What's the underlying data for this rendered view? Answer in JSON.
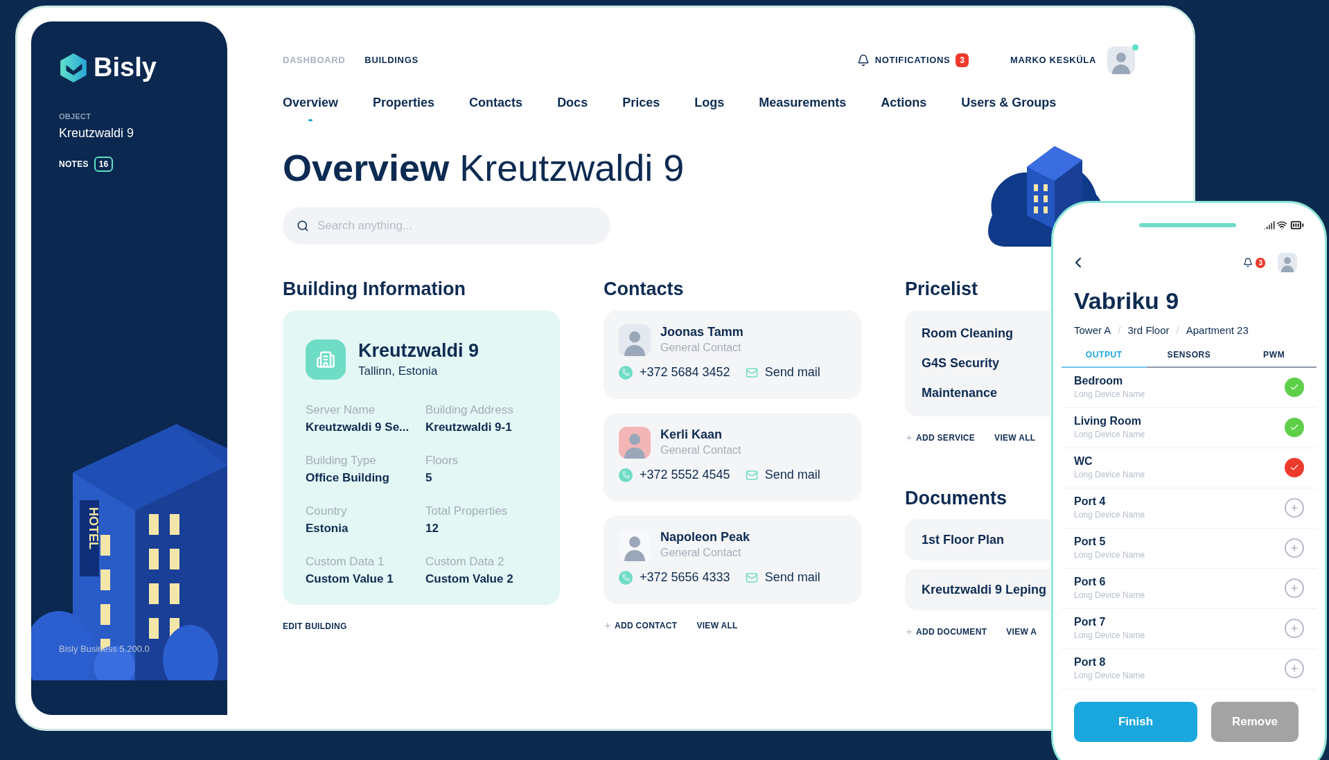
{
  "sidebar": {
    "logo": "Bisly",
    "object_label": "OBJECT",
    "object_name": "Kreutzwaldi 9",
    "notes_label": "NOTES",
    "notes_count": "16",
    "sign": "HOTEL",
    "version": "Bisly Business 5.200.0"
  },
  "topbar": {
    "crumbs": [
      {
        "label": "DASHBOARD",
        "selected": false
      },
      {
        "label": "BUILDINGS",
        "selected": true
      }
    ],
    "notifications_label": "NOTIFICATIONS",
    "notifications_count": "3",
    "user_name": "MARKO KESKÜLA",
    "user_online": true
  },
  "nav": [
    {
      "label": "Overview",
      "selected": true
    },
    {
      "label": "Properties",
      "selected": false
    },
    {
      "label": "Contacts",
      "selected": false
    },
    {
      "label": "Docs",
      "selected": false
    },
    {
      "label": "Prices",
      "selected": false
    },
    {
      "label": "Logs",
      "selected": false
    },
    {
      "label": "Measurements",
      "selected": false
    },
    {
      "label": "Actions",
      "selected": false
    },
    {
      "label": "Users & Groups",
      "selected": false
    }
  ],
  "title": {
    "main": "Overview",
    "sub": "Kreutzwaldi 9"
  },
  "search": {
    "placeholder": "Search anything..."
  },
  "building": {
    "heading": "Building Information",
    "name": "Kreutzwaldi 9",
    "location": "Tallinn, Estonia",
    "fields": [
      {
        "label": "Server Name",
        "value": "Kreutzwaldi 9 Se..."
      },
      {
        "label": "Building Address",
        "value": "Kreutzwaldi 9-1"
      },
      {
        "label": "Building Type",
        "value": "Office Building"
      },
      {
        "label": "Floors",
        "value": "5"
      },
      {
        "label": "Country",
        "value": "Estonia"
      },
      {
        "label": "Total Properties",
        "value": "12"
      },
      {
        "label": "Custom Data 1",
        "value": "Custom Value 1"
      },
      {
        "label": "Custom Data 2",
        "value": "Custom Value 2"
      }
    ],
    "edit_link": "EDIT BUILDING"
  },
  "contacts": {
    "heading": "Contacts",
    "items": [
      {
        "name": "Joonas Tamm",
        "role": "General Contact",
        "phone": "+372 5684 3452",
        "mail": "Send mail"
      },
      {
        "name": "Kerli Kaan",
        "role": "General Contact",
        "phone": "+372 5552 4545",
        "mail": "Send mail"
      },
      {
        "name": "Napoleon Peak",
        "role": "General Contact",
        "phone": "+372 5656 4333",
        "mail": "Send mail"
      }
    ],
    "add_link": "ADD CONTACT",
    "view_link": "VIEW ALL"
  },
  "pricelist": {
    "heading": "Pricelist",
    "items": [
      "Room Cleaning",
      "G4S Security",
      "Maintenance"
    ],
    "add_link": "ADD SERVICE",
    "view_link": "VIEW ALL"
  },
  "documents": {
    "heading": "Documents",
    "items": [
      "1st Floor Plan",
      "Kreutzwaldi 9 Leping"
    ],
    "add_link": "ADD DOCUMENT",
    "view_link": "VIEW A"
  },
  "phone": {
    "notifications_count": "3",
    "title": "Vabriku 9",
    "breadcrumb": [
      "Tower A",
      "3rd Floor",
      "Apartment 23"
    ],
    "separator": "/",
    "tabs": [
      {
        "label": "OUTPUT",
        "selected": true
      },
      {
        "label": "SENSORS",
        "selected": false
      },
      {
        "label": "PWM",
        "selected": false
      }
    ],
    "rows": [
      {
        "name": "Bedroom",
        "device": "Long Device Name",
        "kind": "ok"
      },
      {
        "name": "Living Room",
        "device": "Long Device Name",
        "kind": "ok"
      },
      {
        "name": "WC",
        "device": "Long Device Name",
        "kind": "error"
      },
      {
        "name": "Port 4",
        "device": "Long Device Name",
        "kind": "add"
      },
      {
        "name": "Port 5",
        "device": "Long Device Name",
        "kind": "add"
      },
      {
        "name": "Port 6",
        "device": "Long Device Name",
        "kind": "add"
      },
      {
        "name": "Port 7",
        "device": "Long Device Name",
        "kind": "add"
      },
      {
        "name": "Port 8",
        "device": "Long Device Name",
        "kind": "add"
      }
    ],
    "buttons": [
      {
        "label": "Finish",
        "disabled": false
      },
      {
        "label": "Remove",
        "disabled": true
      }
    ]
  }
}
